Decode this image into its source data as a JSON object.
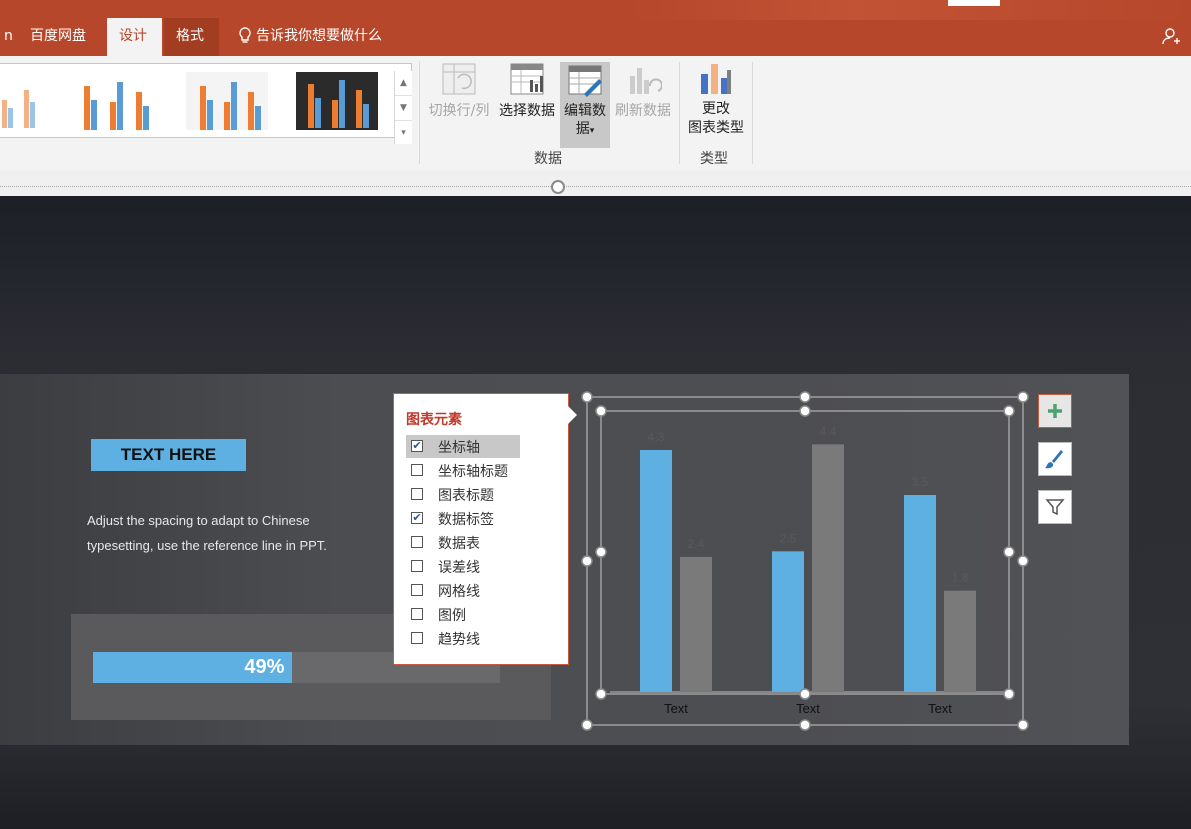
{
  "tabs": {
    "partial_left": "n",
    "baidu": "百度网盘",
    "design": "设计",
    "format": "格式",
    "tell_me": "告诉我你想要做什么",
    "share_partial": "共"
  },
  "ribbon": {
    "data_group": {
      "switch_row_col": "切换行/列",
      "select_data": "选择数据",
      "edit_data_line1": "编辑数",
      "edit_data_line2": "据",
      "refresh_data": "刷新数据",
      "label": "数据"
    },
    "type_group": {
      "change_type_line1": "更改",
      "change_type_line2": "图表类型",
      "label": "类型"
    }
  },
  "slide": {
    "heading": "TEXT HERE",
    "paragraph": "Adjust the spacing to adapt to Chinese typesetting, use the reference line in PPT.",
    "progress": {
      "percent": 49,
      "label": "49%"
    }
  },
  "popup": {
    "title": "图表元素",
    "items": [
      {
        "label": "坐标轴",
        "checked": true
      },
      {
        "label": "坐标轴标题",
        "checked": false
      },
      {
        "label": "图表标题",
        "checked": false
      },
      {
        "label": "数据标签",
        "checked": true
      },
      {
        "label": "数据表",
        "checked": false
      },
      {
        "label": "误差线",
        "checked": false
      },
      {
        "label": "网格线",
        "checked": false
      },
      {
        "label": "图例",
        "checked": false
      },
      {
        "label": "趋势线",
        "checked": false
      }
    ]
  },
  "colors": {
    "accent": "#b7472a",
    "series1": "#5eb0e2",
    "series2": "#7a7a7a"
  },
  "chart_data": {
    "type": "bar",
    "categories": [
      "Text",
      "Text",
      "Text"
    ],
    "series": [
      {
        "values": [
          4.3,
          2.5,
          3.5
        ],
        "color": "#5eb0e2"
      },
      {
        "values": [
          2.4,
          4.4,
          1.8
        ],
        "color": "#7a7a7a"
      }
    ],
    "ylim": [
      0,
      4.3
    ],
    "grid": false,
    "data_labels": true,
    "legend": "none"
  },
  "side_buttons": [
    "plus-icon",
    "brush-icon",
    "filter-icon"
  ]
}
